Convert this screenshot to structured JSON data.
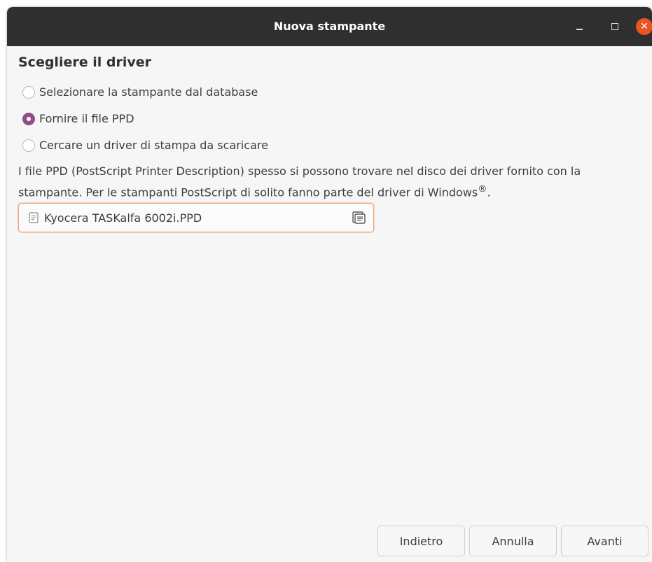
{
  "window": {
    "title": "Nuova stampante",
    "controls": {
      "minimize_icon": "minimize-icon",
      "maximize_icon": "maximize-icon",
      "close_icon": "close-icon",
      "close_glyph": "✕",
      "close_color": "#e95420"
    }
  },
  "page": {
    "heading": "Scegliere il driver",
    "options": [
      {
        "label": "Selezionare la stampante dal database",
        "checked": false
      },
      {
        "label": "Fornire il file PPD",
        "checked": true
      },
      {
        "label": "Cercare un driver di stampa da scaricare",
        "checked": false
      }
    ],
    "description_line1": "I file PPD (PostScript Printer Description) spesso si possono trovare nel disco dei driver fornito con la",
    "description_line2": "stampante. Per le stampanti PostScript di solito fanno parte del driver di Windows",
    "description_superscript": "®",
    "description_end": ".",
    "accent_color": "#924d8b"
  },
  "file_chooser": {
    "file_icon": "document-icon",
    "file_name": "Kyocera TASKalfa 6002i.PPD",
    "browse_icon": "folder-browse-icon"
  },
  "buttons": {
    "back": "Indietro",
    "cancel": "Annulla",
    "next": "Avanti"
  }
}
